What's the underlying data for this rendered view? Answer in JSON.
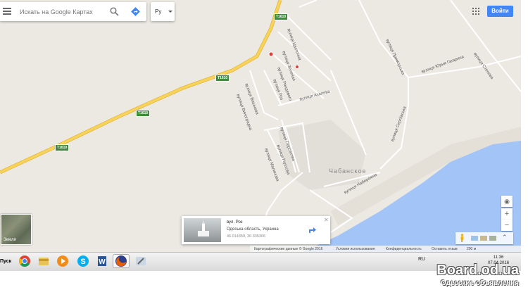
{
  "search": {
    "placeholder": "Искать на Google Картах"
  },
  "language_button": {
    "label": "Ру"
  },
  "signin_button": {
    "label": "Войти"
  },
  "map": {
    "road_shields": [
      "T1610",
      "T1610",
      "T1610",
      "T1610"
    ],
    "village_name": "Чабанское",
    "streets": [
      "вулиця Цветочна",
      "вулиця Зеленая",
      "вулиця Рандевого",
      "вулиця Роз",
      "вулиця Виноградна",
      "вулиця Вишнева",
      "вулиця Азалева",
      "вулиця Приморська",
      "вулиця Юрия Гагарина",
      "вулиця Степова",
      "вулиця Сергіївська",
      "вулиця Набережна",
      "вулиця Персикова",
      "вулиця Горіхова",
      "вулиця Малинова"
    ],
    "water_color": "#a3c4f7",
    "land_color": "#ece9e3",
    "highway_color": "#f7d35c"
  },
  "earth_toggle": {
    "label": "Земля"
  },
  "info_card": {
    "title": "вул. Роз",
    "address": "Одеська область, Украина",
    "coords": "46.014359, 30.335306"
  },
  "footer": {
    "data_label": "Картографические данные © Google 2016",
    "terms": "Условия использования",
    "privacy": "Конфиденциальность",
    "feedback": "Оставить отзыв",
    "scale": "200 м"
  },
  "zoom": {
    "in": "+",
    "out": "−"
  },
  "taskbar": {
    "start_label": "Пуск",
    "lang": "RU",
    "time": "11:36",
    "date": "07.04.2016",
    "icons": [
      "chrome-icon",
      "explorer-icon",
      "media-player-icon",
      "skype-icon",
      "word-icon",
      "firefox-icon",
      "tools-icon"
    ]
  },
  "watermark": {
    "line1": "Board.od.ua",
    "line2": "Одесские объявления"
  }
}
